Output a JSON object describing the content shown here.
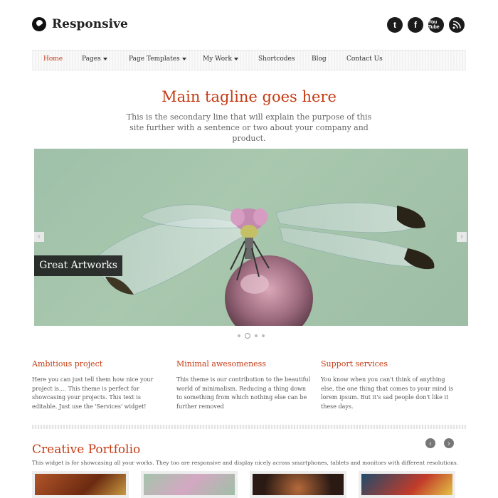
{
  "brand": {
    "name": "Responsive"
  },
  "social": [
    {
      "label": "t",
      "icon": "twitter-icon"
    },
    {
      "label": "f",
      "icon": "facebook-icon"
    },
    {
      "label": "You Tube",
      "icon": "youtube-icon"
    },
    {
      "label": "rss",
      "icon": "rss-icon"
    }
  ],
  "nav": {
    "home": "Home",
    "pages": "Pages",
    "page_templates": "Page Templates",
    "my_work": "My Work",
    "shortcodes": "Shortcodes",
    "blog": "Blog",
    "contact": "Contact Us"
  },
  "hero": {
    "tagline": "Main tagline goes here",
    "secondary": "This is the secondary line that will explain the purpose of this site further with a sentence or two about your company and product."
  },
  "slider": {
    "caption": "Great Artworks",
    "prev": "‹",
    "next": "›",
    "active_slide": 2,
    "slide_count": 4
  },
  "features": [
    {
      "title": "Ambitious project",
      "body": "Here you can just tell them how nice your project is.... This theme is perfect for showcasing your projects. This text is editable. Just use the 'Services' widget!"
    },
    {
      "title": "Minimal awesomeness",
      "body": "This theme is our contribution to the beautiful world of minimalism. Reducing a thing down to something from which nothing else can be further removed"
    },
    {
      "title": "Support services",
      "body": "You know when you can't think of anything else, the one thing that comes to your mind is lorem ipsum. But it's sad people don't like it these days."
    }
  ],
  "portfolio": {
    "title": "Creative Portfolio",
    "description": "This widget is for showcasing all your works. They too are responsive and display nicely across smartphones, tablets and monitors with different resolutions.",
    "prev": "‹",
    "next": "›"
  },
  "colors": {
    "accent": "#c43c15"
  }
}
